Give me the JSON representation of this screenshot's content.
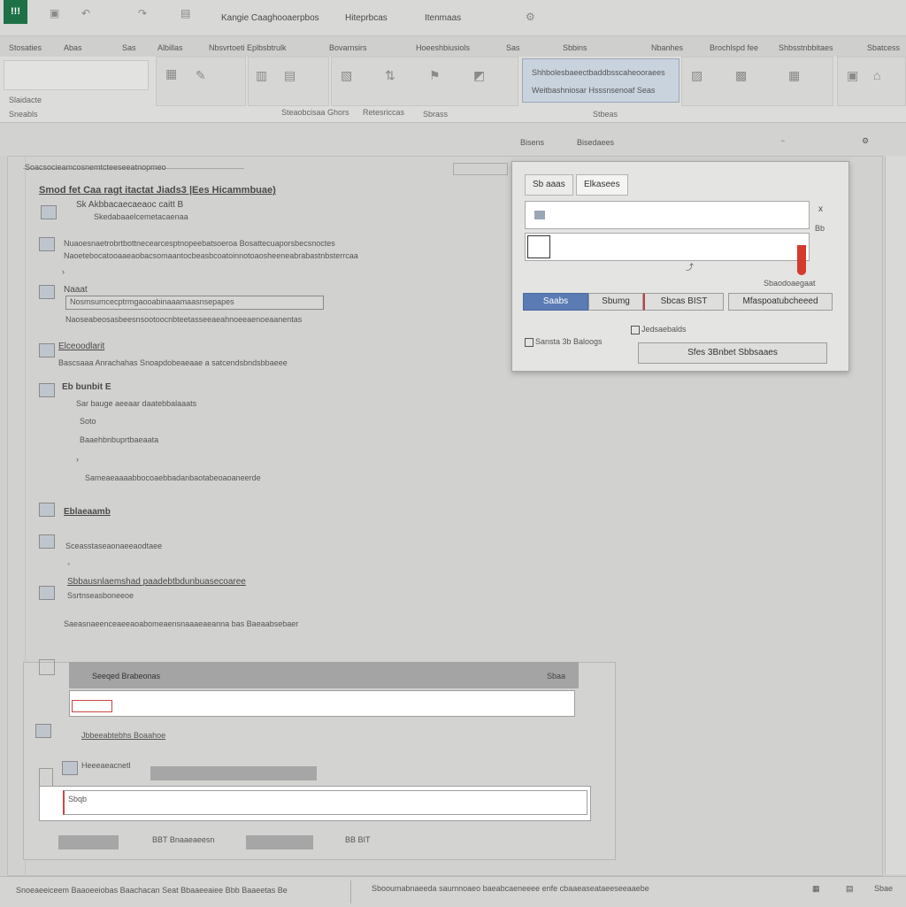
{
  "titlebar": {
    "app_badge": "!!!",
    "center_title": "Kangie Caaghooaerpbos",
    "item_a": "Hiteprbcas",
    "item_b": "Itenmaas"
  },
  "ribbon_tabs": [
    "Stosaties",
    "Abas",
    "Sas",
    "Albillas",
    "Nbsvrtoeti Eplbsbtrulk",
    "Bovarnsirs",
    "Hoeeshbiusiols",
    "Sas",
    "Sbbins",
    "Nbanhes",
    "Brochlspd fee",
    "Shbsstnbbitaes",
    "Sbatcess"
  ],
  "ribbon_groups": {
    "left_label": "Slaidacte",
    "left_sub": "Sneabls",
    "mid_label_1": "Steaobcisaa Ghors",
    "mid_label_2": "Retesriccas",
    "mid_label_3": "Sbrass",
    "right_label": "Stbeas",
    "highlight_text": "Weitbashniosar Hsssnsenoaf Seas",
    "highlight_top": "Shhbolesbaeectbaddbsscaheooraees"
  },
  "subbar": {
    "item_1": "Bisens",
    "item_2": "Bisedaees"
  },
  "canvas": {
    "header_line": "Soacsocieamcosnemtcteeseeatnopmeo",
    "title": "Smod fet Caa ragt itactat Jiads3 |Ees Hicammbuae)",
    "subtitle": "Sk Akbbacaecaeaoc caitt B",
    "sub_line": "Skedabaaelcemetacaenaa",
    "para_1": "Nuaoesnaetrobrtbottnecearcesptnopeebatsoeroa Bosattecuaporsbecsnoctes",
    "para_2": "Naoetebocatooaaeaobacsomaantocbeasbcoatoinnotoaosheeneabrabastnbsterrcaa",
    "item_label_1": "Naaat",
    "field_line": "Nosmsumcecptrmgaooabinaaamaasnsepapes",
    "para_3": "Naoseabeosasbeesnsootoocnbteetasseeaeahnoeeaenoeaanentas",
    "block_title": "Elceoodlarit",
    "block_line": "Bascsaaa Anrachahas Snoapdobeaeaae a satcendsbndsbbaeee",
    "sec_title": "Eb bunbit E",
    "sec_line_1": "Sar bauge aeeaar daatebbalaaats",
    "sec_line_2": "Soto",
    "sec_line_3": "Baaehbnbuprtbaeaata",
    "sec_line_4": "Sameaeaaaabbocoaebbadanbaotabeoaoaneerde",
    "label_2": "Eblaeaamb",
    "line_5": "Sceasstaseaonaeeaodtaee",
    "line_6": "Sbbausnlaemshad paadebtbdunbuasecoaree",
    "line_7": "Ssrtnseasboneeoe",
    "line_8": "Saeasnaeenceaeeaoabomeaensnaaaeaeanna bas Baeaabsebaer"
  },
  "dialog": {
    "tab_1": "Sb aaas",
    "tab_2": "Elkasees",
    "close": "x",
    "side": "Bb",
    "link_text": "Sbaodoaegaat",
    "btn_primary": "Saabs",
    "btn_2": "Sbumg",
    "btn_3": "Sbcas BIST",
    "btn_4": "Mfaspoatubcheeed",
    "check_1": "Jedsaebalds",
    "check_2": "Sansta 3b Baloogs",
    "btn_wide": "Sfes 3Bnbet Sbbsaaes"
  },
  "lower_panel": {
    "header_text": "Seeqed Brabeonas",
    "header_right": "Sbaa",
    "label_1": "Jbbeeabtebhs Boaahoe",
    "label_2": "Heeeaeacnetl",
    "input_value": "Sbqb",
    "btn_left": "",
    "btn_mid": "BBT Bnaaeaeesn",
    "btn_right": "",
    "btn_end": "BB BIT"
  },
  "statusbar": {
    "left_text": "Snoeaeeiceem Baaoeeiobas Baachacan Seat Bbaaeeaiee Bbb Baaeetas Be",
    "right_text": "Sbooumabnaeeda saumnoaeo baeabcaeneeee enfe cbaaeaseataeeseeaaebe",
    "end_text": "Sbae"
  }
}
